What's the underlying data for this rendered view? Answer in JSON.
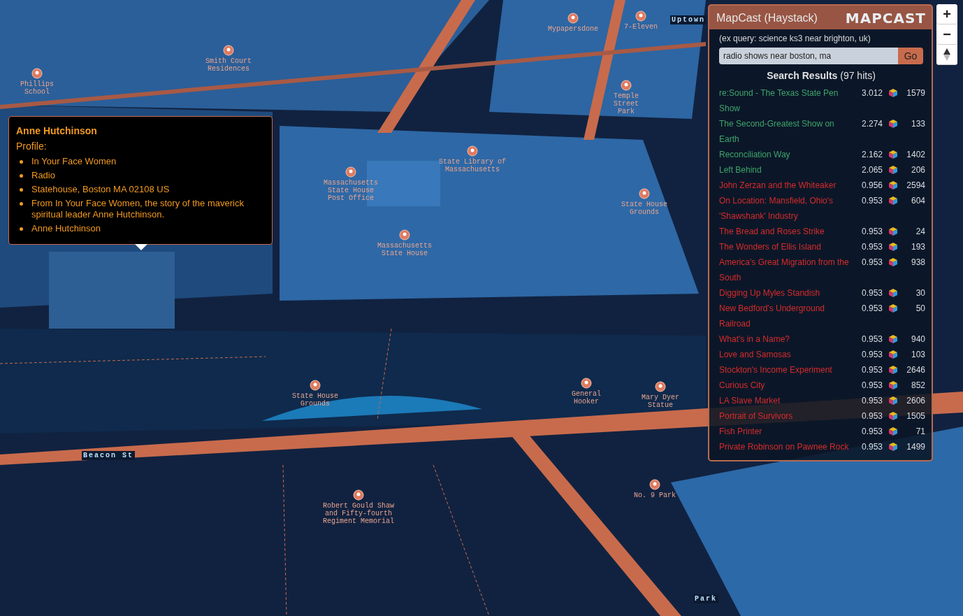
{
  "map_labels": [
    {
      "kind": "place",
      "text": "Phillips School"
    },
    {
      "kind": "place",
      "text": "Smith Court Residences"
    },
    {
      "kind": "place",
      "text": "Mypapersdone"
    },
    {
      "kind": "place",
      "text": "7-Eleven"
    },
    {
      "kind": "place",
      "text": "Temple Street Park"
    },
    {
      "kind": "place",
      "text": "State Library of Massachusetts"
    },
    {
      "kind": "place",
      "text": "Massachusetts State House Post Office"
    },
    {
      "kind": "place",
      "text": "State House Grounds"
    },
    {
      "kind": "place",
      "text": "Massachusetts State House"
    },
    {
      "kind": "place",
      "text": "State House Grounds"
    },
    {
      "kind": "place",
      "text": "General Hooker"
    },
    {
      "kind": "place",
      "text": "Mary Dyer Statue"
    },
    {
      "kind": "place",
      "text": "Robert Gould Shaw and Fifty-fourth Regiment Memorial"
    },
    {
      "kind": "place",
      "text": "No. 9 Park"
    },
    {
      "kind": "street",
      "text": "Beacon St"
    },
    {
      "kind": "street",
      "text": "Park"
    },
    {
      "kind": "street",
      "text": "Uptown"
    }
  ],
  "popup": {
    "title": "Anne Hutchinson",
    "subtitle": "Profile:",
    "items": [
      "In Your Face Women",
      "Radio",
      "Statehouse, Boston MA 02108 US",
      "From In Your Face Women, the story of the maverick spiritual leader Anne Hutchinson.",
      "Anne Hutchinson"
    ]
  },
  "panel": {
    "title": "MapCast (Haystack)",
    "logo": "MAPCAST",
    "hint": "(ex query: science ks3 near brighton, uk)",
    "search": {
      "value": "radio shows near boston, ma"
    },
    "go_button": "Go",
    "results_heading": "Search Results",
    "hits": "(97 hits)",
    "results": [
      {
        "title": "re:Sound - The Texas State Pen Show",
        "score": "3.012",
        "count": "1579",
        "color": "#3fa36b"
      },
      {
        "title": "The Second-Greatest Show on Earth",
        "score": "2.274",
        "count": "133",
        "color": "#3fa36b"
      },
      {
        "title": "Reconciliation Way",
        "score": "2.162",
        "count": "1402",
        "color": "#3fa36b"
      },
      {
        "title": "Left Behind",
        "score": "2.065",
        "count": "206",
        "color": "#3fa36b"
      },
      {
        "title": "John Zerzan and the Whiteaker",
        "score": "0.956",
        "count": "2594",
        "color": "#d62b2b"
      },
      {
        "title": "On Location: Mansfield, Ohio's 'Shawshank' Industry",
        "score": "0.953",
        "count": "604",
        "color": "#d62b2b"
      },
      {
        "title": "The Bread and Roses Strike",
        "score": "0.953",
        "count": "24",
        "color": "#d62b2b"
      },
      {
        "title": "The Wonders of Ellis Island",
        "score": "0.953",
        "count": "193",
        "color": "#d62b2b"
      },
      {
        "title": "America's Great Migration from the South",
        "score": "0.953",
        "count": "938",
        "color": "#d62b2b"
      },
      {
        "title": "Digging Up Myles Standish",
        "score": "0.953",
        "count": "30",
        "color": "#d62b2b"
      },
      {
        "title": "New Bedford's Underground Railroad",
        "score": "0.953",
        "count": "50",
        "color": "#d62b2b"
      },
      {
        "title": "What's in a Name?",
        "score": "0.953",
        "count": "940",
        "color": "#d62b2b"
      },
      {
        "title": "Love and Samosas",
        "score": "0.953",
        "count": "103",
        "color": "#d62b2b"
      },
      {
        "title": "Stockton's Income Experiment",
        "score": "0.953",
        "count": "2646",
        "color": "#d62b2b"
      },
      {
        "title": "Curious City",
        "score": "0.953",
        "count": "852",
        "color": "#d62b2b"
      },
      {
        "title": "LA Slave Market",
        "score": "0.953",
        "count": "2606",
        "color": "#d62b2b"
      },
      {
        "title": "Portrait of Survivors",
        "score": "0.953",
        "count": "1505",
        "color": "#d62b2b"
      },
      {
        "title": "Fish Printer",
        "score": "0.953",
        "count": "71",
        "color": "#d62b2b"
      },
      {
        "title": "Private Robinson on Pawnee Rock",
        "score": "0.953",
        "count": "1499",
        "color": "#d62b2b"
      }
    ]
  },
  "zoom_in": "+",
  "zoom_out": "−"
}
